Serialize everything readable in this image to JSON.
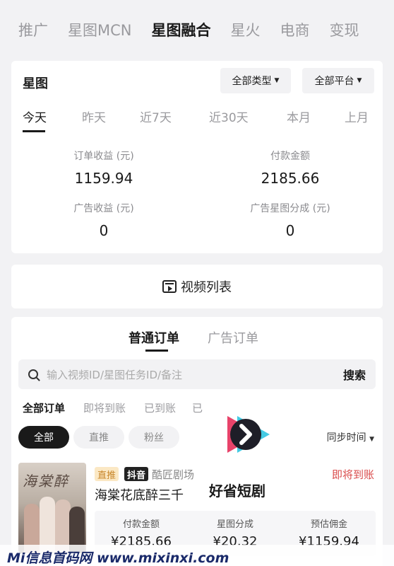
{
  "top_tabs": [
    "推广",
    "星图MCN",
    "星图融合",
    "星火",
    "电商",
    "变现"
  ],
  "stats": {
    "title": "星图",
    "type_filter": "全部类型",
    "platform_filter": "全部平台",
    "periods": [
      "今天",
      "昨天",
      "近7天",
      "近30天",
      "本月",
      "上月"
    ],
    "metrics": [
      {
        "label": "订单收益 (元)",
        "value": "1159.94"
      },
      {
        "label": "付款金额",
        "value": "2185.66"
      },
      {
        "label": "广告收益 (元)",
        "value": "0"
      },
      {
        "label": "广告星图分成 (元)",
        "value": "0"
      }
    ]
  },
  "video_list_label": "视频列表",
  "orders": {
    "tabs": [
      "普通订单",
      "广告订单"
    ],
    "search_placeholder": "输入视频ID/星图任务ID/备注",
    "search_button": "搜索",
    "status_tabs": [
      "全部订单",
      "即将到账",
      "已到账",
      "已"
    ],
    "pills": [
      "全部",
      "直推",
      "粉丝"
    ],
    "sync_time": "同步时间"
  },
  "order_item": {
    "badge_zhitui": "直推",
    "badge_douyin": "抖音",
    "studio": "酷匠剧场",
    "title": "海棠花底醉三千",
    "status": "即将到账",
    "thumb_title": "海棠醉",
    "payment_label": "付款金额",
    "payment_value": "¥2185.66",
    "share_label": "星图分成",
    "share_value": "¥20.32",
    "commission_label": "预估佣金",
    "commission_value": "¥1159.94"
  },
  "overlay_brand": "好省短剧",
  "footer_watermark": "Mi信息首码网  www.mixinxi.com",
  "colors": {
    "accent_red": "#d94a4a",
    "badge_orange": "#c8862a",
    "logo_pink": "#e8436a",
    "logo_cyan": "#2fc4e0"
  }
}
